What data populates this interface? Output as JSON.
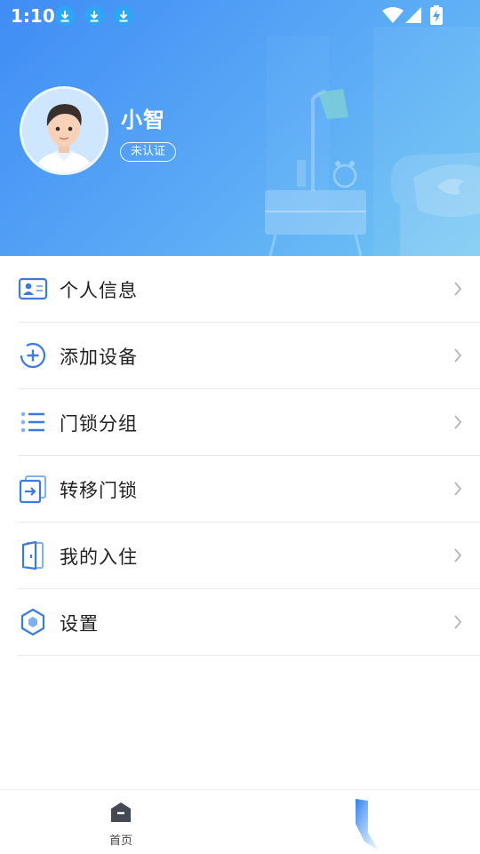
{
  "status_bar": {
    "time": "1:10",
    "icons": [
      "download-icon",
      "download-icon",
      "download-icon",
      "wifi-icon",
      "signal-icon",
      "battery-charging-icon"
    ]
  },
  "profile": {
    "name": "小智",
    "verify_status": "未认证"
  },
  "menu": {
    "items": [
      {
        "label": "个人信息",
        "icon": "id-card-icon"
      },
      {
        "label": "添加设备",
        "icon": "add-circle-icon"
      },
      {
        "label": "门锁分组",
        "icon": "list-icon"
      },
      {
        "label": "转移门锁",
        "icon": "transfer-icon"
      },
      {
        "label": "我的入住",
        "icon": "door-icon"
      },
      {
        "label": "设置",
        "icon": "hexagon-settings-icon"
      }
    ]
  },
  "bottom_nav": {
    "tabs": [
      {
        "label": "首页",
        "icon": "home-icon"
      },
      {
        "label": "",
        "icon": "mine-icon"
      }
    ]
  },
  "colors": {
    "header_start": "#3f8cf5",
    "header_end": "#71c7f3",
    "icon_blue": "#3a7be0",
    "text_dark": "#222222"
  }
}
